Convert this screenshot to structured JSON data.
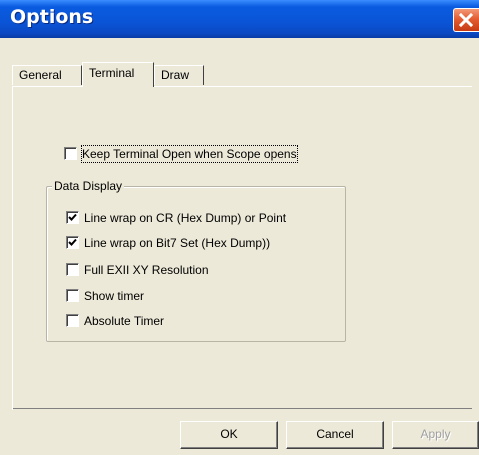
{
  "window": {
    "title": "Options",
    "close_icon": "close-icon"
  },
  "tabs": [
    {
      "label": "General",
      "active": false
    },
    {
      "label": "Terminal",
      "active": true
    },
    {
      "label": "Draw",
      "active": false
    }
  ],
  "terminal": {
    "keep_open": {
      "label": "Keep Terminal Open when Scope opens",
      "checked": false
    },
    "data_display": {
      "label": "Data Display",
      "options": [
        {
          "label": "Line wrap on CR (Hex Dump) or Point",
          "checked": true
        },
        {
          "label": "Line wrap on Bit7 Set (Hex Dump))",
          "checked": true
        },
        {
          "label": "Full EXII XY Resolution",
          "checked": false
        },
        {
          "label": "Show timer",
          "checked": false
        },
        {
          "label": "Absolute Timer",
          "checked": false
        }
      ]
    }
  },
  "buttons": {
    "ok": "OK",
    "cancel": "Cancel",
    "apply": "Apply",
    "apply_enabled": false
  },
  "colors": {
    "titlebar": "#0a54d6",
    "close_button": "#e35d32",
    "dialog_bg": "#ece9d8"
  }
}
